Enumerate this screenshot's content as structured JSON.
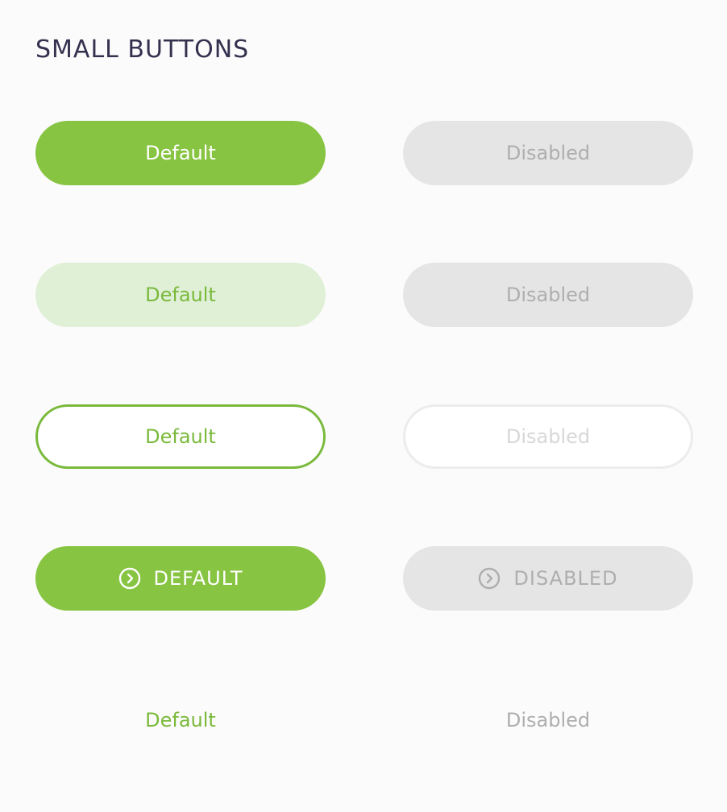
{
  "section": {
    "title": "SMALL BUTTONS"
  },
  "buttons": {
    "filled": {
      "default_label": "Default",
      "disabled_label": "Disabled"
    },
    "tonal": {
      "default_label": "Default",
      "disabled_label": "Disabled"
    },
    "outlined": {
      "default_label": "Default",
      "disabled_label": "Disabled"
    },
    "icon": {
      "default_label": "DEFAULT",
      "disabled_label": "DISABLED",
      "icon_name": "chevron-right-circle-icon"
    },
    "text": {
      "default_label": "Default",
      "disabled_label": "Disabled"
    }
  },
  "colors": {
    "accent": "#87c442",
    "accent_text": "#7ab93c",
    "accent_tint": "#dff0d6",
    "disabled_bg": "#e5e5e5",
    "disabled_text": "#aeaeae",
    "heading": "#34314f",
    "page_bg": "#fbfbfb"
  }
}
